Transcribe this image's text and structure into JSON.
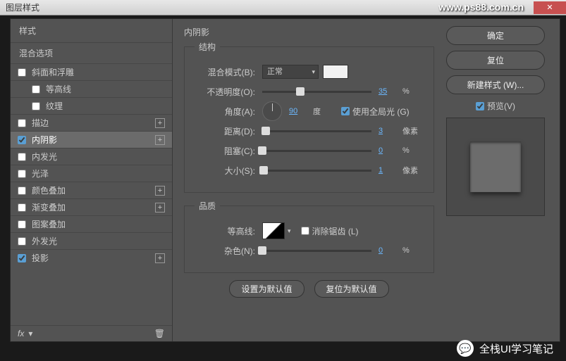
{
  "title": "图层样式",
  "watermark": "www.ps88.com.cn",
  "sidebar": {
    "header": "样式",
    "sub": "混合选项",
    "items": [
      {
        "label": "斜面和浮雕",
        "checked": false,
        "indent": false,
        "plus": false
      },
      {
        "label": "等高线",
        "checked": false,
        "indent": true,
        "plus": false
      },
      {
        "label": "纹理",
        "checked": false,
        "indent": true,
        "plus": false
      },
      {
        "label": "描边",
        "checked": false,
        "indent": false,
        "plus": true
      },
      {
        "label": "内阴影",
        "checked": true,
        "indent": false,
        "plus": true,
        "active": true
      },
      {
        "label": "内发光",
        "checked": false,
        "indent": false,
        "plus": false
      },
      {
        "label": "光泽",
        "checked": false,
        "indent": false,
        "plus": false
      },
      {
        "label": "颜色叠加",
        "checked": false,
        "indent": false,
        "plus": true
      },
      {
        "label": "渐变叠加",
        "checked": false,
        "indent": false,
        "plus": true
      },
      {
        "label": "图案叠加",
        "checked": false,
        "indent": false,
        "plus": false
      },
      {
        "label": "外发光",
        "checked": false,
        "indent": false,
        "plus": false
      },
      {
        "label": "投影",
        "checked": true,
        "indent": false,
        "plus": true
      }
    ],
    "footer_fx": "fx"
  },
  "panel": {
    "title": "内阴影",
    "structure": {
      "legend": "结构",
      "blend_label": "混合模式(B):",
      "blend_value": "正常",
      "opacity_label": "不透明度(O):",
      "opacity_value": "35",
      "opacity_unit": "%",
      "angle_label": "角度(A):",
      "angle_value": "90",
      "angle_unit": "度",
      "global_label": "使用全局光 (G)",
      "global_checked": true,
      "distance_label": "距离(D):",
      "distance_value": "3",
      "distance_unit": "像素",
      "choke_label": "阻塞(C):",
      "choke_value": "0",
      "choke_unit": "%",
      "size_label": "大小(S):",
      "size_value": "1",
      "size_unit": "像素"
    },
    "quality": {
      "legend": "品质",
      "contour_label": "等高线:",
      "antialias_label": "消除锯齿 (L)",
      "antialias_checked": false,
      "noise_label": "杂色(N):",
      "noise_value": "0",
      "noise_unit": "%"
    },
    "default_btn": "设置为默认值",
    "reset_btn": "复位为默认值"
  },
  "right": {
    "ok": "确定",
    "cancel": "复位",
    "newstyle": "新建样式 (W)...",
    "preview_label": "预览(V)",
    "preview_checked": true
  },
  "credit": "全栈UI学习笔记"
}
